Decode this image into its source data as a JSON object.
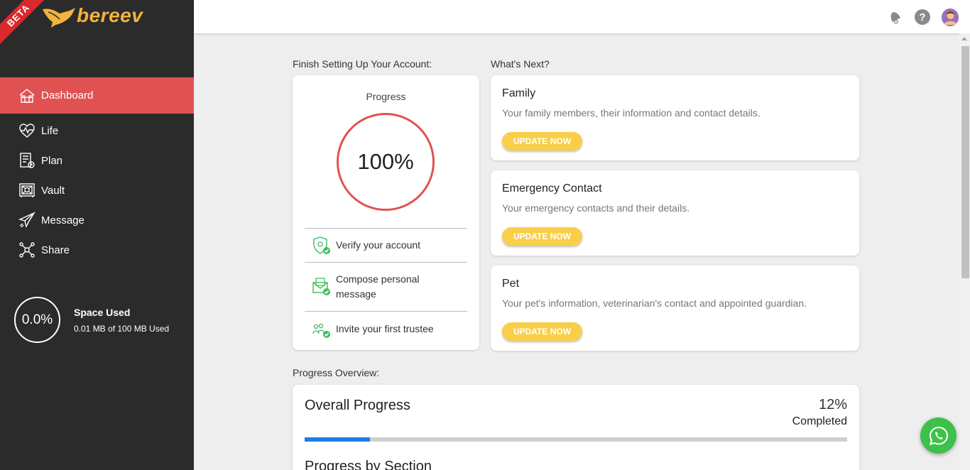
{
  "brand": {
    "name": "bereev",
    "badge": "BETA",
    "color": "#f3b33d"
  },
  "sidebar": {
    "items": [
      {
        "label": "Dashboard",
        "icon": "house-icon",
        "active": true
      },
      {
        "label": "Life",
        "icon": "heartbeat-icon"
      },
      {
        "label": "Plan",
        "icon": "checklist-icon"
      },
      {
        "label": "Vault",
        "icon": "vault-icon"
      },
      {
        "label": "Message",
        "icon": "paper-plane-icon"
      },
      {
        "label": "Share",
        "icon": "share-nodes-icon"
      }
    ],
    "space": {
      "percent": "0.0%",
      "title": "Space Used",
      "detail": "0.01 MB of 100 MB Used"
    }
  },
  "header": {
    "icons": [
      "notification-bell-icon",
      "help-icon",
      "user-avatar"
    ],
    "help_glyph": "?"
  },
  "setup": {
    "label": "Finish Setting Up Your Account:",
    "progress_title": "Progress",
    "progress_value": "100%",
    "tasks": [
      {
        "label": "Verify your account",
        "done": true
      },
      {
        "label": "Compose personal message",
        "done": true
      },
      {
        "label": "Invite your first trustee",
        "done": true
      }
    ]
  },
  "whats_next": {
    "label": "What's Next?",
    "cards": [
      {
        "title": "Family",
        "desc": "Your family members, their information and contact details.",
        "button": "UPDATE NOW"
      },
      {
        "title": "Emergency Contact",
        "desc": "Your emergency contacts and their details.",
        "button": "UPDATE NOW"
      },
      {
        "title": "Pet",
        "desc": "Your pet's information, veterinarian's contact and appointed guardian.",
        "button": "UPDATE NOW"
      }
    ]
  },
  "overview": {
    "label": "Progress Overview:",
    "title": "Overall Progress",
    "percent": "12%",
    "progress_fraction": 0.12,
    "status": "Completed",
    "subtitle": "Progress by Section"
  },
  "colors": {
    "accent": "#e05252",
    "sidebar": "#2b2b2b",
    "button": "#f9cf4a",
    "progress": "#1e7ee8",
    "whatsapp": "#3dc14b"
  }
}
